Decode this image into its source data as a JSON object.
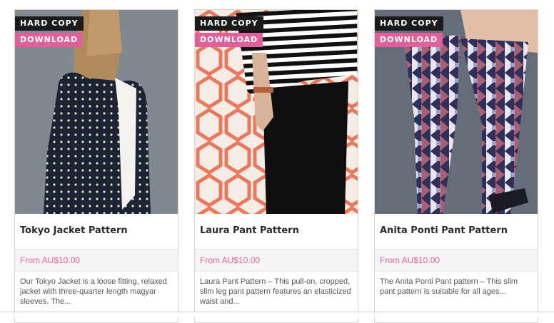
{
  "products": [
    {
      "badge_hardcopy": "HARD COPY",
      "badge_download": "DOWNLOAD",
      "title": "Tokyo Jacket Pattern",
      "price": "From AU$10.00",
      "description": "Our Tokyo Jacket is a loose fitting, relaxed jacket with three-quarter length magyar sleeves. The..."
    },
    {
      "badge_hardcopy": "HARD COPY",
      "badge_download": "DOWNLOAD",
      "title": "Laura Pant Pattern",
      "price": "From AU$10.00",
      "description": "Laura Pant Pattern – This pull-on, cropped, slim leg pant pattern features an elasticized waist and..."
    },
    {
      "badge_hardcopy": "HARD COPY",
      "badge_download": "DOWNLOAD",
      "title": "Anita Ponti Pant Pattern",
      "price": "From AU$10.00",
      "description": "The Anita Ponti Pant pattern – This slim pant pattern is suitable for all ages..."
    }
  ],
  "colors": {
    "accent_pink": "#e0609a",
    "badge_dark": "#1b1b1b"
  }
}
